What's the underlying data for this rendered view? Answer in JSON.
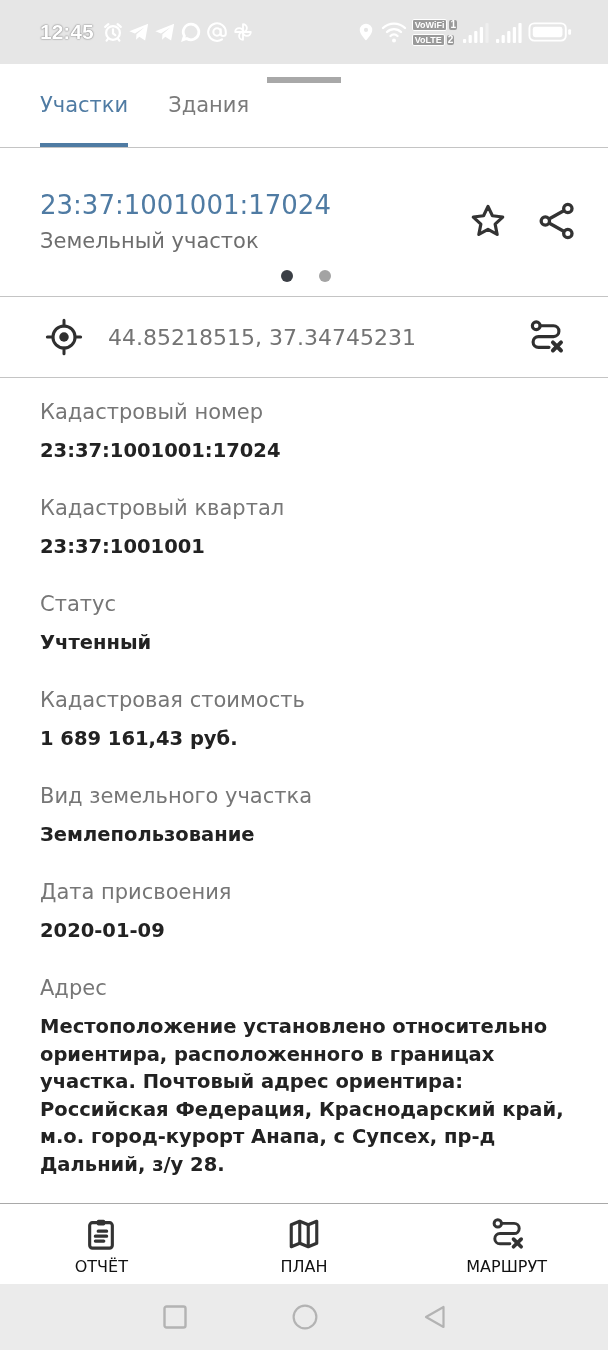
{
  "status_bar": {
    "time": "12:45",
    "sim_badges": [
      {
        "label": "VoWiFi",
        "slot": "1"
      },
      {
        "label": "VoLTE",
        "slot": "2"
      }
    ]
  },
  "tabs": [
    {
      "label": "Участки",
      "selected": true
    },
    {
      "label": "Здания",
      "selected": false
    }
  ],
  "header": {
    "title": "23:37:1001001:17024",
    "subtitle": "Земельный участок",
    "favorite": false,
    "pages": [
      {
        "selected": true
      },
      {
        "selected": false
      }
    ]
  },
  "location": {
    "coordinates": "44.85218515, 37.34745231"
  },
  "fields": [
    {
      "label": "Кадастровый номер",
      "value": "23:37:1001001:17024"
    },
    {
      "label": "Кадастровый квартал",
      "value": "23:37:1001001"
    },
    {
      "label": "Статус",
      "value": "Учтенный"
    },
    {
      "label": "Кадастровая стоимость",
      "value": "1 689 161,43 руб."
    },
    {
      "label": "Вид земельного участка",
      "value": "Землепользование"
    },
    {
      "label": "Дата присвоения",
      "value": "2020-01-09"
    },
    {
      "label": "Адрес",
      "value": "Местоположение установлено относительно ориентира, расположенного в границах участка. Почтовый адрес ориентира: Российская Федерация, Краснодарский край, м.о. город-курорт Анапа, с Супсех, пр-д Дальний, з/у 28."
    }
  ],
  "actions": [
    {
      "label": "ОТЧЁТ",
      "kind": "report"
    },
    {
      "label": "ПЛАН",
      "kind": "plan"
    },
    {
      "label": "МАРШРУТ",
      "kind": "route"
    }
  ]
}
